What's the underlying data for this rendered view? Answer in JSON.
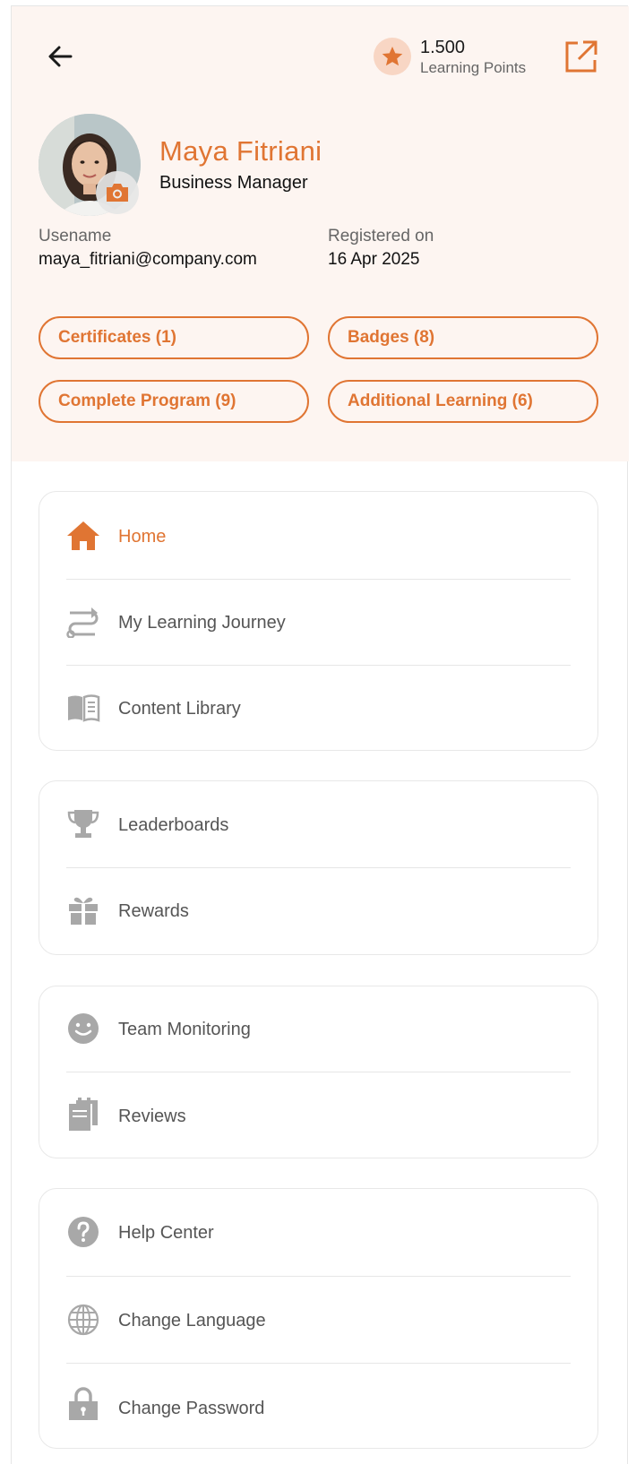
{
  "header": {
    "points": {
      "value": "1.500",
      "label": "Learning Points"
    },
    "profile": {
      "name": "Maya Fitriani",
      "role": "Business Manager"
    },
    "username": {
      "label": "Usename",
      "value": "maya_fitriani@company.com"
    },
    "registered": {
      "label": "Registered on",
      "value": "16 Apr 2025"
    },
    "pills": {
      "certificates": "Certificates (1)",
      "badges": "Badges (8)",
      "complete_program": "Complete Program (9)",
      "additional_learning": "Additional Learning (6)"
    }
  },
  "menu": {
    "home": "Home",
    "learning_journey": "My Learning Journey",
    "content_library": "Content Library",
    "leaderboards": "Leaderboards",
    "rewards": "Rewards",
    "team_monitoring": "Team Monitoring",
    "reviews": "Reviews",
    "help_center": "Help Center",
    "change_language": "Change Language",
    "change_password": "Change Password"
  },
  "icons": {
    "back": "arrow-left-icon",
    "star": "star-icon",
    "share": "external-link-icon",
    "camera": "camera-icon",
    "home": "home-icon",
    "route": "route-icon",
    "book": "book-icon",
    "trophy": "trophy-icon",
    "gift": "gift-icon",
    "smile": "smile-icon",
    "clipboard": "clipboard-icon",
    "help": "help-icon",
    "globe": "globe-icon",
    "lock": "lock-icon"
  },
  "colors": {
    "accent": "#e07533",
    "header_bg": "#fdf5f1",
    "icon_gray": "#a8a8a8",
    "text_gray": "#555555"
  }
}
